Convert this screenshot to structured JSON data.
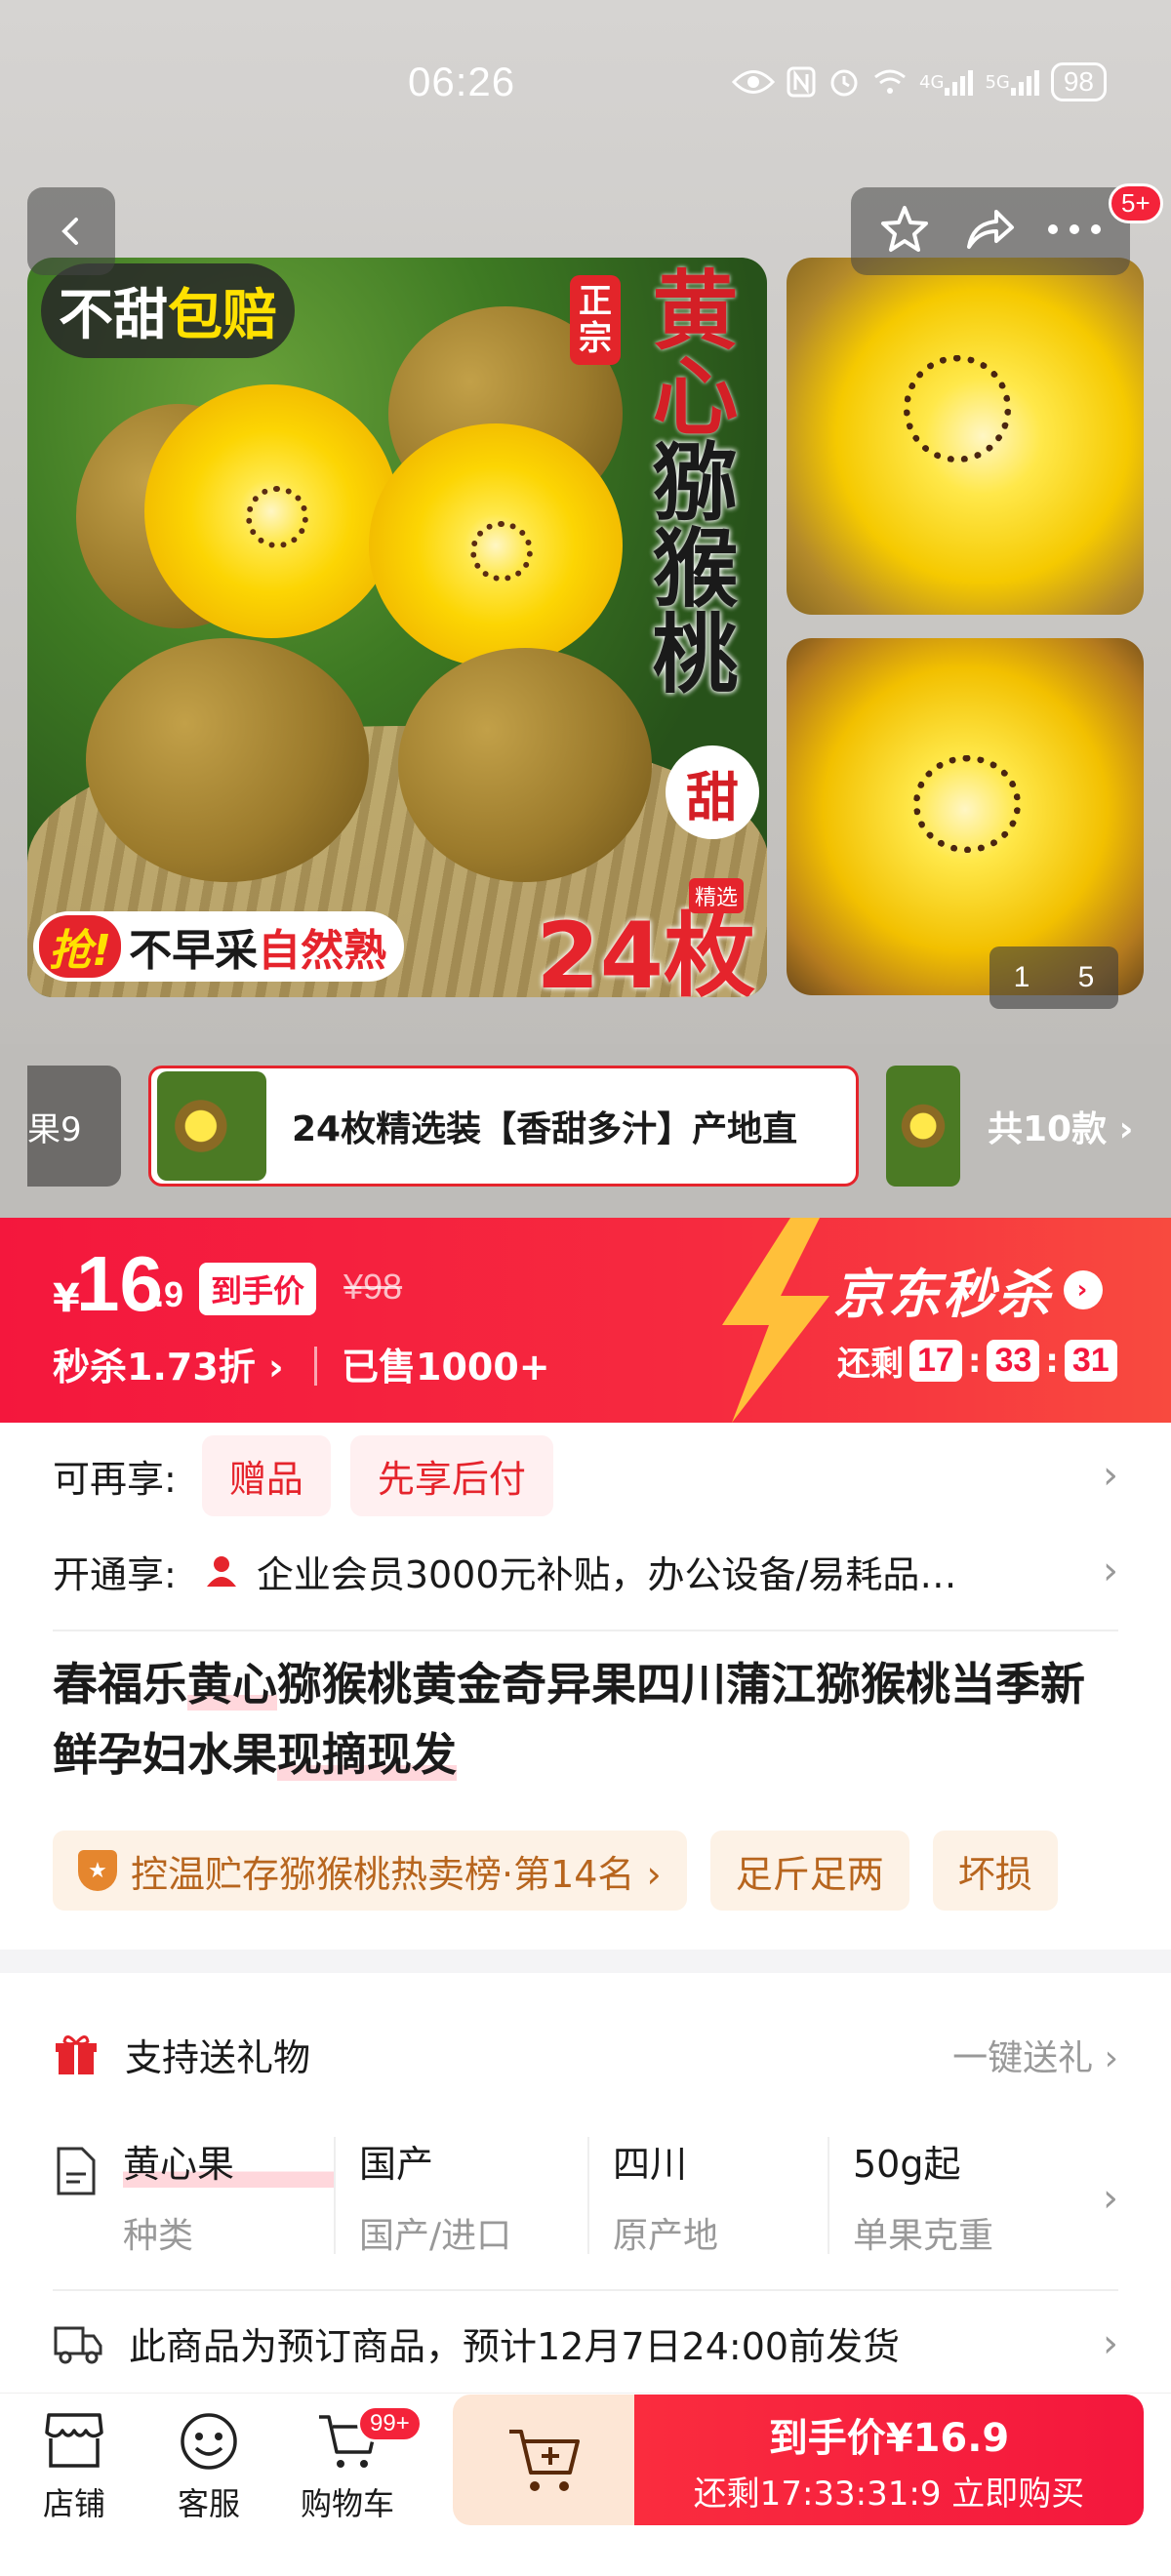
{
  "status": {
    "time": "06:26",
    "network1": "4G",
    "network2": "5G",
    "battery": "98"
  },
  "header": {
    "badge": "5+"
  },
  "gallery": {
    "tag_left_a": "不甜",
    "tag_left_b": "包赔",
    "zhengzong": "正宗",
    "title_red": "黄心",
    "title_black": "猕猴桃",
    "sweet": "甜",
    "grab_q": "抢!",
    "grab_a": "不早采",
    "grab_b": "自然熟",
    "selected_tag": "精选",
    "count": "24枚",
    "page_current": "1",
    "page_total": "5"
  },
  "variants": {
    "left_label": "果9",
    "selected": "24枚精选装【香甜多汁】产地直",
    "total": "共10款 ›"
  },
  "price": {
    "currency": "¥",
    "int": "16",
    "dec": ".9",
    "tag": "到手价",
    "original": "¥98",
    "discount": "秒杀1.73折 ›",
    "sold": "已售1000+",
    "event": "京东秒杀",
    "remaining": "还剩",
    "hh": "17",
    "mm": "33",
    "ss": "31"
  },
  "promo": {
    "enjoy_label": "可再享:",
    "chip1": "赠品",
    "chip2": "先享后付",
    "open_label": "开通享:",
    "open_text": "企业会员3000元补贴，办公设备/易耗品…"
  },
  "product": {
    "title_p1": "春福乐",
    "title_hl1": "黄心",
    "title_p2": "猕猴桃黄金奇异果四川蒲江猕猴桃当季新鲜孕妇水果",
    "title_hl2": "现摘现发",
    "rank": "控温贮存猕猴桃热卖榜·第14名 ›",
    "tag2": "足斤足两",
    "tag3": "坏损"
  },
  "detail": {
    "gift": "支持送礼物",
    "gift_action": "一键送礼 ›",
    "attrs": [
      {
        "value": "黄心果",
        "key": "种类"
      },
      {
        "value": "国产",
        "key": "国产/进口"
      },
      {
        "value": "四川",
        "key": "原产地"
      },
      {
        "value": "50g起",
        "key": "单果克重"
      }
    ],
    "shipping": "此商品为预订商品，预计12月7日24:00前发货"
  },
  "bottom": {
    "store": "店铺",
    "service": "客服",
    "cart": "购物车",
    "cart_badge": "99+",
    "buy_line1": "到手价¥16.9",
    "buy_line2": "还剩17:33:31:9 立即购买"
  },
  "colors": {
    "accent": "#f4173d",
    "brand_red": "#e5242c",
    "tag_orange": "#b7651e"
  },
  "icons": [
    "back-icon",
    "star-icon",
    "share-icon",
    "more-icon",
    "gift-icon",
    "document-icon",
    "truck-icon",
    "store-icon",
    "service-icon",
    "cart-icon",
    "add-cart-icon",
    "user-icon",
    "rank-icon"
  ]
}
